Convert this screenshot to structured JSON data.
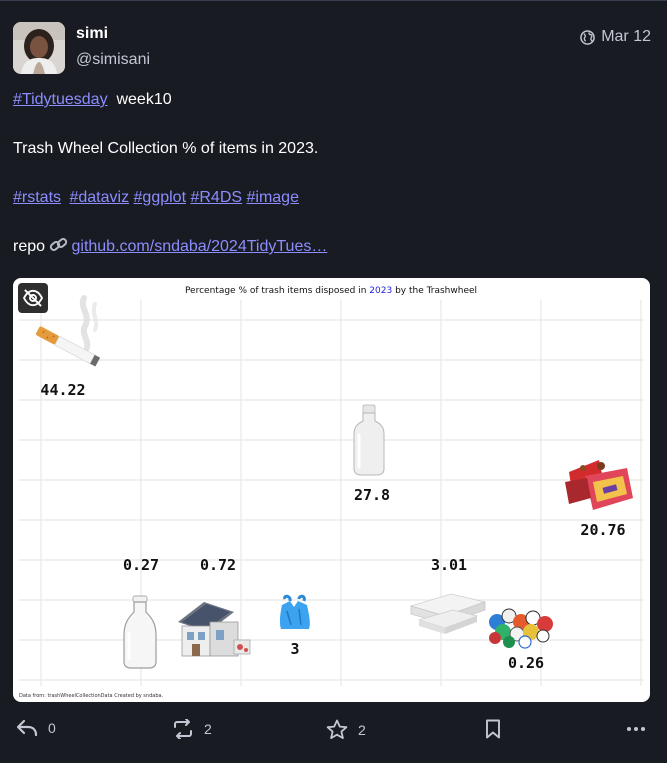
{
  "post": {
    "display_name": "simi",
    "handle": "@simisani",
    "timestamp": "Mar 12",
    "visibility_icon": "globe-icon"
  },
  "content": {
    "line1_hashtag": "#Tidytuesday",
    "line1_text": "week10",
    "line2": "Trash Wheel Collection % of items in 2023.",
    "hashtags": [
      "#rstats",
      "#dataviz",
      "#ggplot",
      "#R4DS",
      "#image"
    ],
    "repo_label": "repo",
    "repo_link_icon": "link-icon",
    "repo_link": "github.com/sndaba/2024TidyTues…"
  },
  "media": {
    "hide_icon": "eye-slash-icon",
    "chart_data": {
      "type": "scatter",
      "title_prefix": "Percentage % of trash items disposed in",
      "title_year": "2023",
      "title_suffix": "by the Trashwheel",
      "caption": "Data from: trashWheelCollectionData Created by sndaba.",
      "grid": true,
      "colors": {
        "background": "#ffffff",
        "grid": "#ebebeb",
        "year": "#2323e6",
        "label": "#111111"
      },
      "points": [
        {
          "item": "cigarette",
          "icon": "cigarette-icon",
          "label": "44.22",
          "value": 44.22
        },
        {
          "item": "plastic bottle",
          "icon": "plastic-bottle-icon",
          "label": "27.8",
          "value": 27.8
        },
        {
          "item": "wrapper",
          "icon": "wrapper-icon",
          "label": "20.76",
          "value": 20.76
        },
        {
          "item": "glass bottle",
          "icon": "glass-bottle-icon",
          "label": "0.27",
          "value": 0.27
        },
        {
          "item": "home",
          "icon": "house-icon",
          "label": "0.72",
          "value": 0.72
        },
        {
          "item": "plastic bag",
          "icon": "plastic-bag-icon",
          "label": "3",
          "value": 3
        },
        {
          "item": "polystyrene",
          "icon": "polystyrene-icon",
          "label": "3.01",
          "value": 3.01
        },
        {
          "item": "sports balls",
          "icon": "sports-balls-icon",
          "label": "0.26",
          "value": 0.26
        }
      ]
    }
  },
  "actions": {
    "reply": {
      "icon": "reply-icon",
      "count": "0"
    },
    "boost": {
      "icon": "boost-icon",
      "count": "2"
    },
    "favourite": {
      "icon": "star-icon",
      "count": "2"
    },
    "bookmark": {
      "icon": "bookmark-icon"
    },
    "more": {
      "icon": "more-icon"
    }
  }
}
